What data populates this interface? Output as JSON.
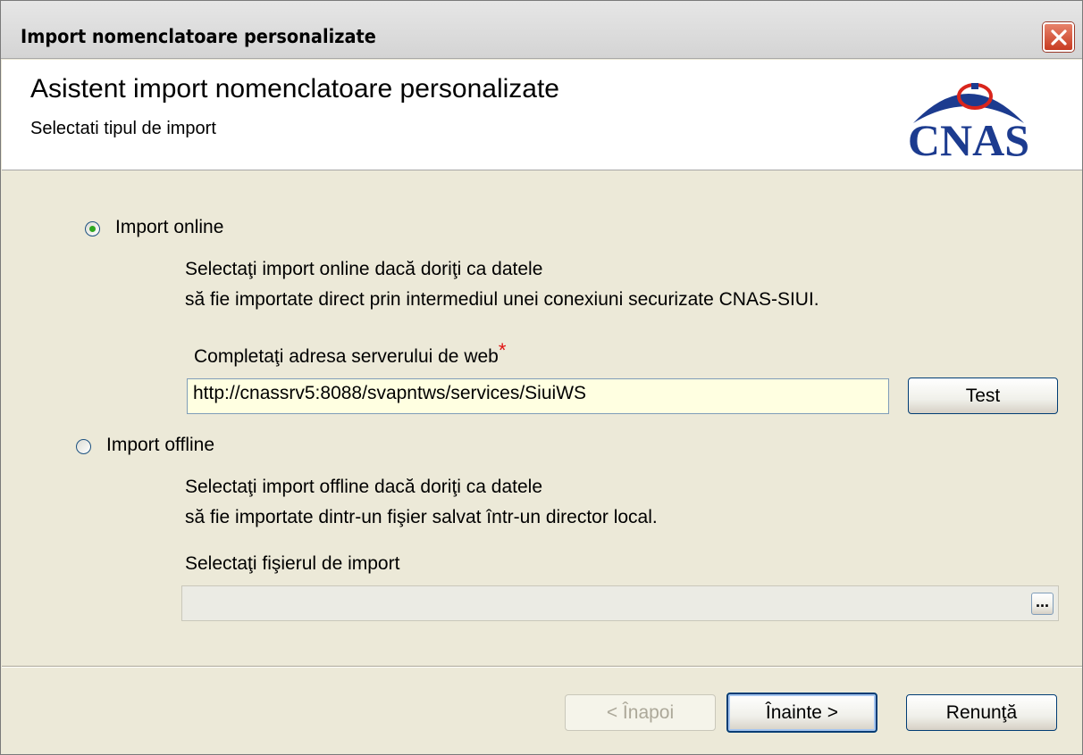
{
  "window": {
    "title": "Import nomenclatoare personalizate"
  },
  "header": {
    "title": "Asistent import nomenclatoare personalizate",
    "subtitle": "Selectati tipul de import",
    "logo_text": "CNAS",
    "logo_color": "#1c3b8f",
    "logo_accent": "#d9251c"
  },
  "online": {
    "label": "Import online",
    "selected": true,
    "desc_line1": "Selectaţi import online dacă doriţi ca datele",
    "desc_line2": "să fie importate direct prin intermediul unei conexiuni securizate CNAS-SIUI.",
    "server_label": "Completaţi adresa serverului de web",
    "required_mark": "*",
    "server_value": "http://cnassrv5:8088/svapntws/services/SiuiWS",
    "test_button": "Test"
  },
  "offline": {
    "label": "Import offline",
    "selected": false,
    "desc_line1": "Selectaţi import offline dacă doriţi ca datele",
    "desc_line2": "să fie importate dintr-un fişier salvat într-un director local.",
    "file_label": "Selectaţi fişierul de import",
    "file_value": "",
    "browse_button": "..."
  },
  "footer": {
    "back_button": "< Înapoi",
    "next_button": "Înainte >",
    "cancel_button": "Renunţă"
  }
}
